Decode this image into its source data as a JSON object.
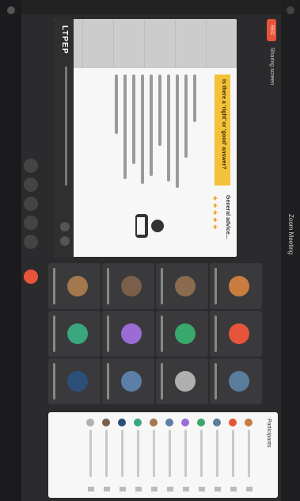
{
  "window": {
    "title": "Zoom Meeting"
  },
  "toolbar": {
    "record_label": "REC",
    "share_title": "Sharing screen"
  },
  "slide": {
    "question": "Is there a ‘right’ or ‘good’ answer?",
    "advice_title": "General advice...",
    "brand": "LTPEP"
  },
  "participants_panel": {
    "header": "Participants"
  },
  "colors": {
    "accent": "#e8543a",
    "slide_yellow": "#f3c23a",
    "star": "#f0a72a"
  },
  "icons": [
    "mic-icon",
    "video-icon",
    "share-screen-icon",
    "chat-icon",
    "participants-icon",
    "leave-icon",
    "person-icon",
    "star-icon"
  ]
}
